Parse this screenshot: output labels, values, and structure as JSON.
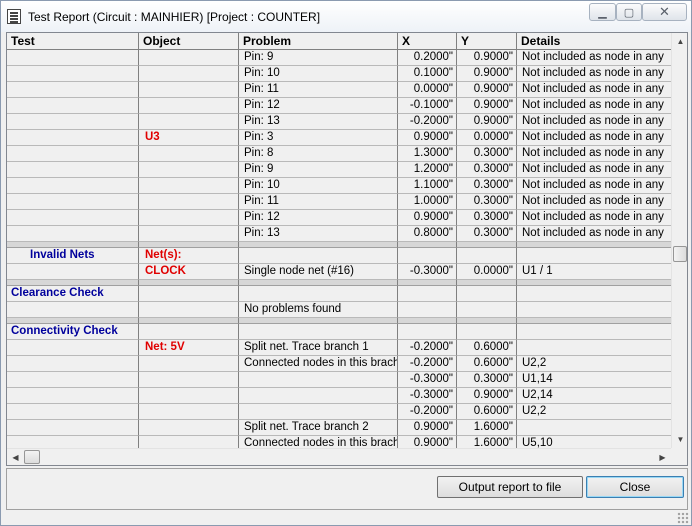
{
  "window": {
    "title": "Test Report (Circuit : MAINHIER) [Project : COUNTER]",
    "min_glyph": "▁",
    "max_glyph": "▢",
    "close_glyph": "✕"
  },
  "columns": [
    "Test",
    "Object",
    "Problem",
    "X",
    "Y",
    "Details"
  ],
  "rows": [
    {
      "test": "",
      "object": "",
      "problem": "Pin: 9",
      "x": "0.2000\"",
      "y": "0.9000\"",
      "details": "Not included as node in any"
    },
    {
      "test": "",
      "object": "",
      "problem": "Pin: 10",
      "x": "0.1000\"",
      "y": "0.9000\"",
      "details": "Not included as node in any"
    },
    {
      "test": "",
      "object": "",
      "problem": "Pin: 11",
      "x": "0.0000\"",
      "y": "0.9000\"",
      "details": "Not included as node in any"
    },
    {
      "test": "",
      "object": "",
      "problem": "Pin: 12",
      "x": "-0.1000\"",
      "y": "0.9000\"",
      "details": "Not included as node in any"
    },
    {
      "test": "",
      "object": "",
      "problem": "Pin: 13",
      "x": "-0.2000\"",
      "y": "0.9000\"",
      "details": "Not included as node in any"
    },
    {
      "test": "",
      "object": "U3",
      "problem": "Pin: 3",
      "x": "0.9000\"",
      "y": "0.0000\"",
      "details": "Not included as node in any"
    },
    {
      "test": "",
      "object": "",
      "problem": "Pin: 8",
      "x": "1.3000\"",
      "y": "0.3000\"",
      "details": "Not included as node in any"
    },
    {
      "test": "",
      "object": "",
      "problem": "Pin: 9",
      "x": "1.2000\"",
      "y": "0.3000\"",
      "details": "Not included as node in any"
    },
    {
      "test": "",
      "object": "",
      "problem": "Pin: 10",
      "x": "1.1000\"",
      "y": "0.3000\"",
      "details": "Not included as node in any"
    },
    {
      "test": "",
      "object": "",
      "problem": "Pin: 11",
      "x": "1.0000\"",
      "y": "0.3000\"",
      "details": "Not included as node in any"
    },
    {
      "test": "",
      "object": "",
      "problem": "Pin: 12",
      "x": "0.9000\"",
      "y": "0.3000\"",
      "details": "Not included as node in any"
    },
    {
      "test": "",
      "object": "",
      "problem": "Pin: 13",
      "x": "0.8000\"",
      "y": "0.3000\"",
      "details": "Not included as node in any"
    },
    {
      "type": "sep"
    },
    {
      "test": "Invalid Nets",
      "test_style": "blue-indent",
      "object": "Net(s):",
      "problem": "",
      "x": "",
      "y": "",
      "details": ""
    },
    {
      "test": "",
      "object": "CLOCK",
      "problem": "Single node net (#16)",
      "x": "-0.3000\"",
      "y": "0.0000\"",
      "details": "U1 / 1"
    },
    {
      "type": "sep"
    },
    {
      "test": "Clearance Check",
      "test_style": "blue",
      "object": "",
      "problem": "",
      "x": "",
      "y": "",
      "details": ""
    },
    {
      "test": "",
      "object": "",
      "problem": "No problems found",
      "x": "",
      "y": "",
      "details": ""
    },
    {
      "type": "sep"
    },
    {
      "test": "Connectivity Check",
      "test_style": "blue",
      "object": "",
      "problem": "",
      "x": "",
      "y": "",
      "details": ""
    },
    {
      "test": "",
      "object": "Net: 5V",
      "problem": "Split net. Trace branch 1",
      "x": "-0.2000\"",
      "y": "0.6000\"",
      "details": ""
    },
    {
      "test": "",
      "object": "",
      "problem": "Connected nodes in this brach",
      "x": "-0.2000\"",
      "y": "0.6000\"",
      "details": "U2,2"
    },
    {
      "test": "",
      "object": "",
      "problem": "",
      "x": "-0.3000\"",
      "y": "0.3000\"",
      "details": "U1,14"
    },
    {
      "test": "",
      "object": "",
      "problem": "",
      "x": "-0.3000\"",
      "y": "0.9000\"",
      "details": "U2,14"
    },
    {
      "test": "",
      "object": "",
      "problem": "",
      "x": "-0.2000\"",
      "y": "0.6000\"",
      "details": "U2,2"
    },
    {
      "test": "",
      "object": "",
      "problem": "Split net. Trace branch 2",
      "x": "0.9000\"",
      "y": "1.6000\"",
      "details": ""
    },
    {
      "test": "",
      "object": "",
      "problem": "Connected nodes in this brach",
      "x": "0.9000\"",
      "y": "1.6000\"",
      "details": "U5,10"
    }
  ],
  "scroll": {
    "up_arrow": "▲",
    "down_arrow": "▼",
    "left_arrow": "◀",
    "right_arrow": "▶"
  },
  "buttons": {
    "output": "Output report to file",
    "close": "Close"
  }
}
